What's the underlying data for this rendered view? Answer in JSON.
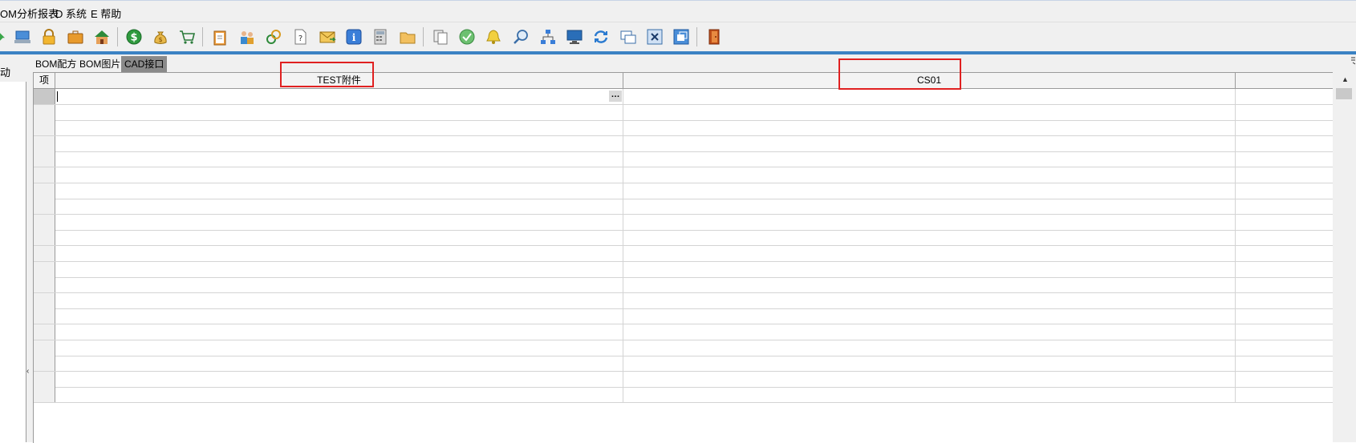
{
  "menu": [
    {
      "id": "report",
      "label": "OM分析报表"
    },
    {
      "id": "system",
      "label": "D 系统"
    },
    {
      "id": "help",
      "label": "E 帮助"
    }
  ],
  "toolbar": {
    "icons": [
      "arrow-icon",
      "computer-icon",
      "lock-icon",
      "briefcase-icon",
      "home-icon",
      "dollar-coin-icon",
      "money-bag-icon",
      "shopping-cart-icon",
      "clipboard-icon",
      "users-icon",
      "link-icon",
      "help-document-icon",
      "mail-icon",
      "info-icon",
      "calculator-icon",
      "folder-icon",
      "copy-document-icon",
      "check-circle-icon",
      "bell-icon",
      "search-icon",
      "org-chart-icon",
      "monitor-icon",
      "refresh-icon",
      "windows-icon",
      "close-box-icon",
      "restore-window-icon",
      "exit-door-icon"
    ]
  },
  "left_panel": {
    "label": "动"
  },
  "tabs": [
    {
      "label": "BOM配方",
      "active": false
    },
    {
      "label": "BOM图片",
      "active": false
    },
    {
      "label": "CAD接口",
      "active": true
    }
  ],
  "grid": {
    "columns": [
      {
        "label": "项"
      },
      {
        "label": "TEST附件"
      },
      {
        "label": "CS01"
      }
    ],
    "row_count": 20,
    "cell_button": "…"
  },
  "colors": {
    "accent": "#3b82c4",
    "highlight_box": "#e02020",
    "active_tab": "#8a8a8a"
  }
}
